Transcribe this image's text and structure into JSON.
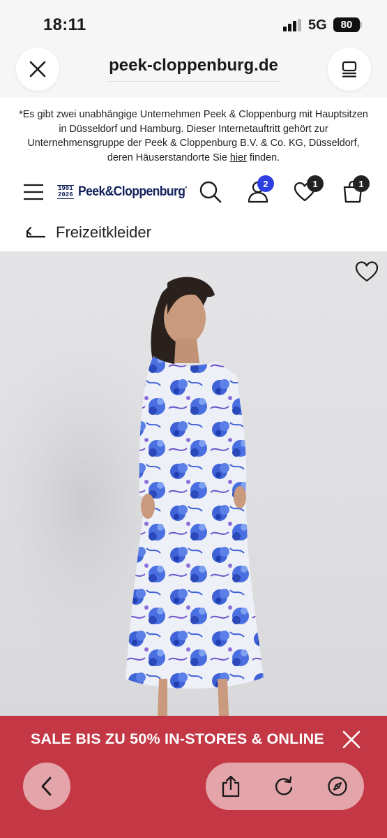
{
  "status_bar": {
    "time": "18:11",
    "network": "5G",
    "battery": "80"
  },
  "browser": {
    "url": "peek-cloppenburg.de",
    "close_icon": "close-icon",
    "tabs_icon": "tab-overview-icon"
  },
  "notice": {
    "text_before_link": "*Es gibt zwei unabhängige Unternehmen Peek & Cloppenburg mit Hauptsitzen in Düsseldorf und Hamburg. Dieser Internetauftritt gehört zur Unternehmensgruppe der Peek & Cloppenburg B.V. & Co. KG, Düsseldorf, deren Häuserstandorte Sie ",
    "link_text": "hier",
    "text_after_link": " finden."
  },
  "header": {
    "logo_years_top": "1901",
    "logo_years_bottom": "2026",
    "logo_name": "Peek&Cloppenburg",
    "logo_mark": "*",
    "account_badge": "2",
    "wishlist_badge": "1",
    "cart_badge": "1",
    "account_badge_color": "#2d3fe0",
    "count_badge_color": "#222222"
  },
  "breadcrumb": {
    "label": "Freizeitkleider"
  },
  "product": {
    "wishlist_icon": "heart-outline-icon"
  },
  "sale_banner": {
    "text": "SALE BIS ZU 50% IN-STORES & ONLINE",
    "background": "#c33844"
  },
  "safari_toolbar": {
    "back_icon": "chevron-left-icon",
    "share_icon": "share-icon",
    "reload_icon": "reload-icon",
    "compass_icon": "compass-icon"
  }
}
